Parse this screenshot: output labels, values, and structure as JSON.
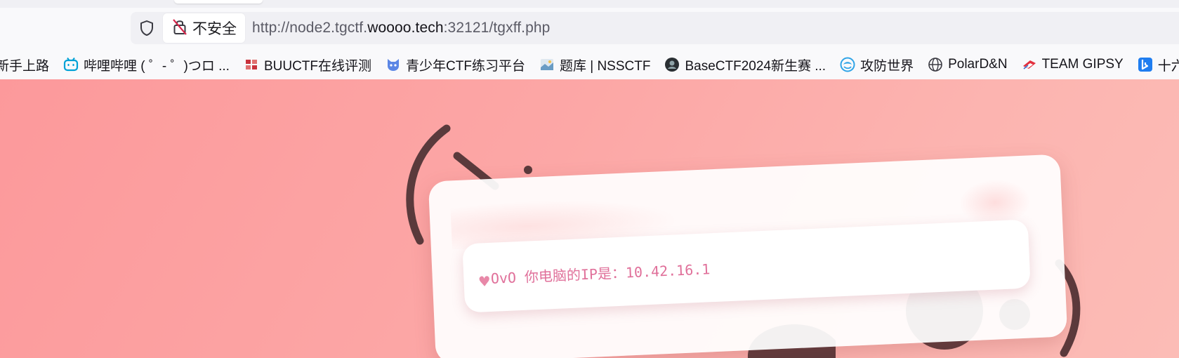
{
  "browser": {
    "security_label": "不安全",
    "url": {
      "scheme_host_prefix": "http://node2.tgctf.",
      "domain": "woooo.tech",
      "suffix": ":32121/tgxff.php"
    }
  },
  "bookmarks": [
    {
      "label": "新手上路",
      "icon": "firefox-icon"
    },
    {
      "label": "哔哩哔哩 ( ゜- ゜)つロ ...",
      "icon": "bilibili-icon"
    },
    {
      "label": "BUUCTF在线评测",
      "icon": "buuctf-icon"
    },
    {
      "label": "青少年CTF练习平台",
      "icon": "qsnctf-icon"
    },
    {
      "label": "题库 | NSSCTF",
      "icon": "nssctf-icon"
    },
    {
      "label": "BaseCTF2024新生赛 ...",
      "icon": "basectf-icon"
    },
    {
      "label": "攻防世界",
      "icon": "adworld-icon"
    },
    {
      "label": "PolarD&N",
      "icon": "globe-icon"
    },
    {
      "label": "TEAM GIPSY",
      "icon": "gipsy-icon"
    },
    {
      "label": "十六夜咲夜|插画",
      "icon": "bing-icon"
    }
  ],
  "page": {
    "message": "OvO 你电脑的IP是：10.42.16.1",
    "heart": "♥"
  },
  "colors": {
    "background_start": "#fc999b",
    "background_end": "#fcbcb6",
    "message_text": "#e0709a",
    "kaomoji_stroke": "#5a3a3c"
  }
}
